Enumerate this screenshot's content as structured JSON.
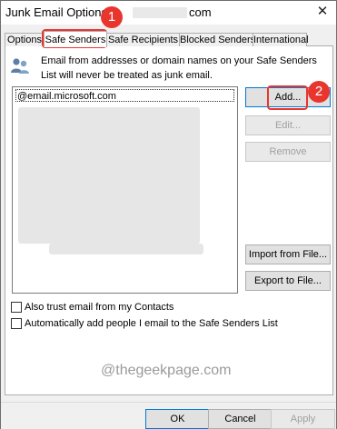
{
  "window": {
    "title_prefix": "Junk Email Options -",
    "title_suffix": "com"
  },
  "tabs": [
    {
      "label": "Options"
    },
    {
      "label": "Safe Senders"
    },
    {
      "label": "Safe Recipients"
    },
    {
      "label": "Blocked Senders"
    },
    {
      "label": "International"
    }
  ],
  "description": "Email from addresses or domain names on your Safe Senders List will never be treated as junk email.",
  "list": {
    "first_item": "@email.microsoft.com"
  },
  "buttons": {
    "add": "Add...",
    "edit": "Edit...",
    "remove": "Remove",
    "import": "Import from File...",
    "export": "Export to File...",
    "ok": "OK",
    "cancel": "Cancel",
    "apply": "Apply"
  },
  "checkboxes": {
    "trust_contacts": "Also trust email from my Contacts",
    "auto_add": "Automatically add people I email to the Safe Senders List"
  },
  "watermark": "@thegeekpage.com",
  "annotations": {
    "step1": "1",
    "step2": "2"
  },
  "colors": {
    "annotation": "#e8362f",
    "focus": "#0078d7"
  },
  "icons": {
    "close": "close-icon",
    "info": "people-icon"
  }
}
